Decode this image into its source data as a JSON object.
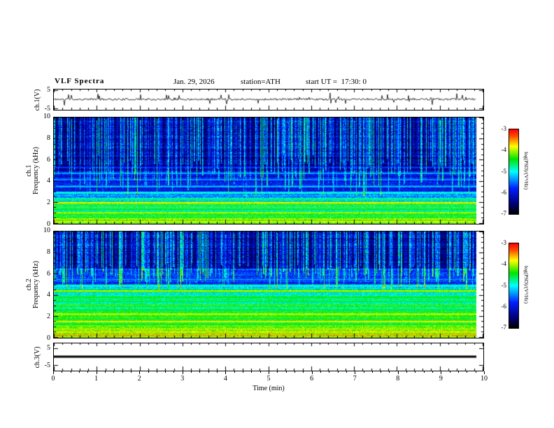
{
  "header": {
    "title": "VLF Spectra",
    "date": "Jan. 29, 2026",
    "station": "station=ATH",
    "start_ut": "start UT =  17:30: 0"
  },
  "x_axis": {
    "label": "Time (min)",
    "ticks": [
      0,
      1,
      2,
      3,
      4,
      5,
      6,
      7,
      8,
      9,
      10
    ],
    "minor_per_major": 4,
    "range": [
      0,
      10
    ]
  },
  "colormap": [
    {
      "t": 0.0,
      "c": [
        0,
        0,
        0
      ]
    },
    {
      "t": 0.12,
      "c": [
        0,
        0,
        120
      ]
    },
    {
      "t": 0.3,
      "c": [
        0,
        30,
        255
      ]
    },
    {
      "t": 0.5,
      "c": [
        0,
        255,
        255
      ]
    },
    {
      "t": 0.65,
      "c": [
        0,
        230,
        0
      ]
    },
    {
      "t": 0.8,
      "c": [
        255,
        255,
        0
      ]
    },
    {
      "t": 0.92,
      "c": [
        255,
        80,
        0
      ]
    },
    {
      "t": 1.0,
      "c": [
        255,
        0,
        0
      ]
    }
  ],
  "chart_data": [
    {
      "type": "line",
      "name": "ch1-waveform",
      "ylabel_lines": [
        "ch.1(V)"
      ],
      "xlim": [
        0,
        10
      ],
      "ylim": [
        -5.6,
        5.6
      ],
      "y_ticks": [
        5,
        -5
      ],
      "line_color": "#000000",
      "seed": 11,
      "noise_amp": 0.55,
      "spike_prob": 0.06,
      "spike_amp_max": 3.2,
      "duration_frac": 0.985,
      "description": "Broadband audio noise trace centered on 0 V with impulsive sferic spikes up to about ±3 V"
    },
    {
      "type": "heatmap",
      "name": "ch1-spectrogram",
      "ylabel_lines": [
        "ch.1",
        "Frequency (kHz)"
      ],
      "xlim": [
        0,
        10
      ],
      "ylim": [
        0,
        10
      ],
      "y_ticks": [
        10,
        8,
        6,
        4,
        2,
        0
      ],
      "y_minor_step": 0.5,
      "seed": 21,
      "noise": 0.35,
      "duration_frac": 0.985,
      "colorbar": {
        "label": "log(PSD)/(V²/Hz)",
        "ticks": [
          -3,
          -4,
          -5,
          -6,
          -7
        ],
        "range": [
          -7,
          -3
        ]
      },
      "bands": [
        {
          "f0": 0,
          "f1": 0.5,
          "level": -4.35
        },
        {
          "f0": 0.5,
          "f1": 1,
          "level": -4.6
        },
        {
          "f0": 1,
          "f1": 2,
          "level": -4.9
        },
        {
          "f0": 2,
          "f1": 3,
          "level": -5.4
        },
        {
          "f0": 3,
          "f1": 5,
          "level": -6.0
        },
        {
          "f0": 5,
          "f1": 10,
          "level": -6.45
        }
      ],
      "hlines": [
        {
          "f": 0.15,
          "level": -3.7
        },
        {
          "f": 0.4,
          "level": -4.05
        },
        {
          "f": 0.7,
          "level": -4.2
        },
        {
          "f": 1.0,
          "level": -3.95
        },
        {
          "f": 1.35,
          "level": -4.35
        },
        {
          "f": 1.65,
          "level": -4.15
        },
        {
          "f": 1.95,
          "level": -3.8
        },
        {
          "f": 2.3,
          "level": -4.6
        },
        {
          "f": 2.9,
          "level": -4.85
        },
        {
          "f": 3.5,
          "level": -5.2
        },
        {
          "f": 4.15,
          "level": -5.35
        },
        {
          "f": 4.75,
          "level": -5.3
        },
        {
          "f": 5.3,
          "level": -5.7
        },
        {
          "f": 6.4,
          "level": -6.1
        }
      ],
      "streaks": {
        "density": 0.5,
        "boost_min": 0.4,
        "boost_max": 2.1,
        "fmin_min": 2.5,
        "fmin_max": 6.5
      },
      "description": "VLF spectrogram: dark-blue background above 5 kHz crossed by dense vertical sferic streaks; increasingly intense cyan/green/yellow horizontal power-line bands below 2 kHz"
    },
    {
      "type": "heatmap",
      "name": "ch2-spectrogram",
      "ylabel_lines": [
        "ch.2",
        "Frequency (kHz)"
      ],
      "xlim": [
        0,
        10
      ],
      "ylim": [
        0,
        10
      ],
      "y_ticks": [
        10,
        8,
        6,
        4,
        2,
        0
      ],
      "y_minor_step": 0.5,
      "seed": 22,
      "noise": 0.35,
      "duration_frac": 0.985,
      "colorbar": {
        "label": "log(PSD)/(V²/Hz)",
        "ticks": [
          -3,
          -4,
          -5,
          -6,
          -7
        ],
        "range": [
          -7,
          -3
        ]
      },
      "bands": [
        {
          "f0": 0,
          "f1": 1,
          "level": -4.3
        },
        {
          "f0": 1,
          "f1": 2.5,
          "level": -4.5
        },
        {
          "f0": 2.5,
          "f1": 4,
          "level": -4.75
        },
        {
          "f0": 4,
          "f1": 5,
          "level": -5.05
        },
        {
          "f0": 5,
          "f1": 6.5,
          "level": -5.75
        },
        {
          "f0": 6.5,
          "f1": 10,
          "level": -6.4
        }
      ],
      "hlines": [
        {
          "f": 0.15,
          "level": -3.45
        },
        {
          "f": 0.5,
          "level": -3.6
        },
        {
          "f": 0.8,
          "level": -3.95
        },
        {
          "f": 1.1,
          "level": -4.1
        },
        {
          "f": 1.5,
          "level": -3.8
        },
        {
          "f": 1.85,
          "level": -4.2
        },
        {
          "f": 2.2,
          "level": -3.9
        },
        {
          "f": 2.6,
          "level": -4.35
        },
        {
          "f": 3.0,
          "level": -4.2
        },
        {
          "f": 3.4,
          "level": -4.5
        },
        {
          "f": 3.8,
          "level": -4.4
        },
        {
          "f": 4.4,
          "level": -3.95
        },
        {
          "f": 4.9,
          "level": -4.8
        },
        {
          "f": 5.5,
          "level": -5.4
        },
        {
          "f": 6.1,
          "level": -5.9
        }
      ],
      "streaks": {
        "density": 0.5,
        "boost_min": 0.4,
        "boost_max": 2.1,
        "fmin_min": 4.5,
        "fmin_max": 7
      },
      "description": "Second channel spectrogram: broad green/cyan band below 5 kHz with yellow and red harmonic lines; dark blue with sferic streaks above 6.5 kHz"
    },
    {
      "type": "flatline",
      "name": "ch3-waveform",
      "ylabel_lines": [
        "ch.3(V)"
      ],
      "xlim": [
        0,
        10
      ],
      "ylim": [
        -8,
        8
      ],
      "y_ticks": [
        5,
        -5
      ],
      "value": 0,
      "line_width": 3,
      "line_color": "#000000",
      "duration_frac": 0.985,
      "description": "Channel 3 is flat at 0 V (no signal)"
    }
  ]
}
